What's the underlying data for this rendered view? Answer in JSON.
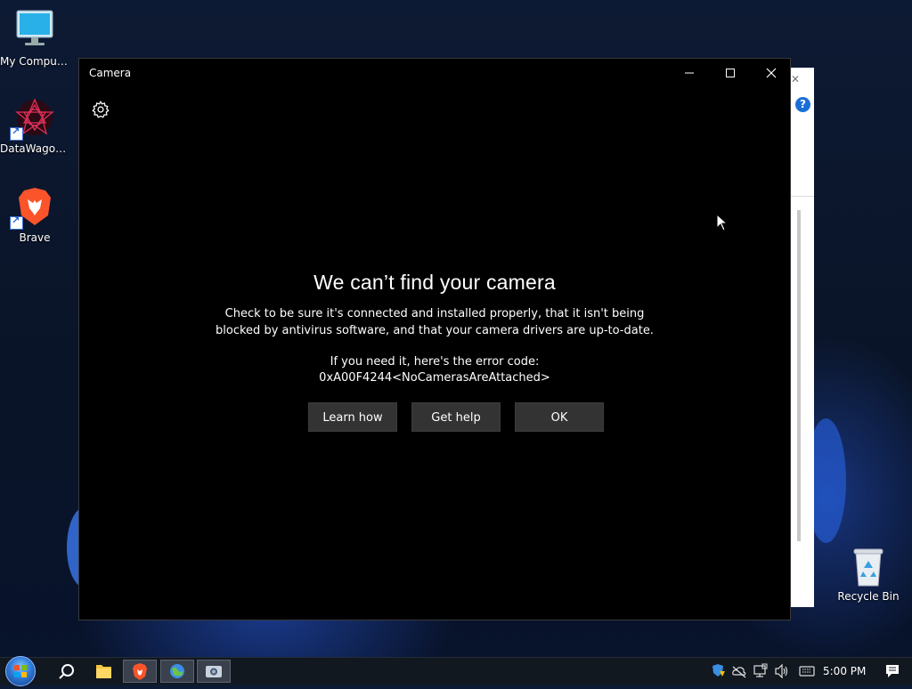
{
  "desktop": {
    "icons": [
      {
        "label": "My Computer"
      },
      {
        "label": "DataWagon..."
      },
      {
        "label": "Brave"
      }
    ],
    "recycle_bin": {
      "label": "Recycle Bin"
    }
  },
  "camera_window": {
    "title": "Camera",
    "error": {
      "heading": "We can’t find your camera",
      "body": "Check to be sure it's connected and installed properly, that it isn't being blocked by antivirus software, and that your camera drivers are up-to-date.",
      "code_label": "If you need it, here's the error code:",
      "code": "0xA00F4244<NoCamerasAreAttached>"
    },
    "buttons": {
      "learn_how": "Learn how",
      "get_help": "Get help",
      "ok": "OK"
    }
  },
  "taskbar": {
    "clock": "5:00 PM",
    "apps": [
      "brave-icon",
      "browser-icon",
      "camera-icon"
    ]
  },
  "colors": {
    "window_bg": "#000000",
    "button_bg": "#333333",
    "taskbar_bg": "#121820"
  }
}
